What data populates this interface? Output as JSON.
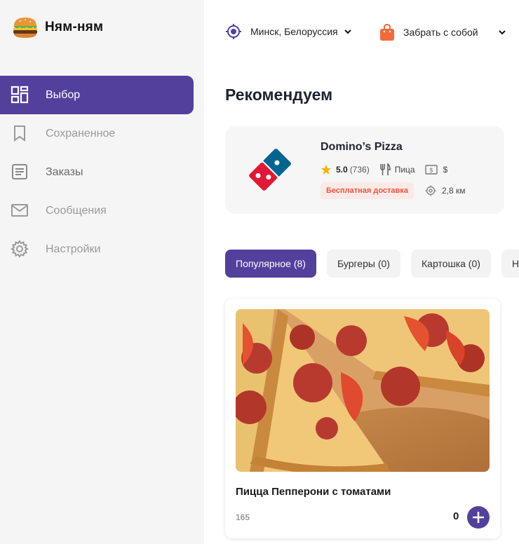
{
  "app": {
    "name": "Ням-ням",
    "logo_icon": "burger-icon"
  },
  "sidebar": {
    "items": [
      {
        "label": "Выбор",
        "icon": "dashboard-icon",
        "active": true
      },
      {
        "label": "Сохраненное",
        "icon": "bookmark-icon",
        "active": false
      },
      {
        "label": "Заказы",
        "icon": "document-icon",
        "active": false
      },
      {
        "label": "Сообщения",
        "icon": "mail-icon",
        "active": false
      },
      {
        "label": "Настройки",
        "icon": "gear-icon",
        "active": false
      }
    ]
  },
  "header": {
    "location": "Минск, Белоруссия",
    "delivery_mode": "Забрать с собой"
  },
  "main": {
    "section_title": "Рекомендуем",
    "restaurant": {
      "name": "Domino’s Pizza",
      "rating": "5.0",
      "reviews": "(736)",
      "cuisine": "Пица",
      "price_level": "$",
      "badge": "Бесплатная доставка",
      "distance": "2,8 км"
    },
    "tabs": [
      {
        "label": "Популярное (8)",
        "active": true
      },
      {
        "label": "Бургеры (0)",
        "active": false
      },
      {
        "label": "Картошка (0)",
        "active": false
      },
      {
        "label": "Н",
        "active": false
      }
    ],
    "product": {
      "name": "Пицца Пепперони с томатами",
      "weight": "165",
      "quantity": "0"
    }
  },
  "colors": {
    "accent": "#53409d",
    "badge_bg": "#fde9e6",
    "badge_text": "#e8533e",
    "star": "#f4b400"
  }
}
